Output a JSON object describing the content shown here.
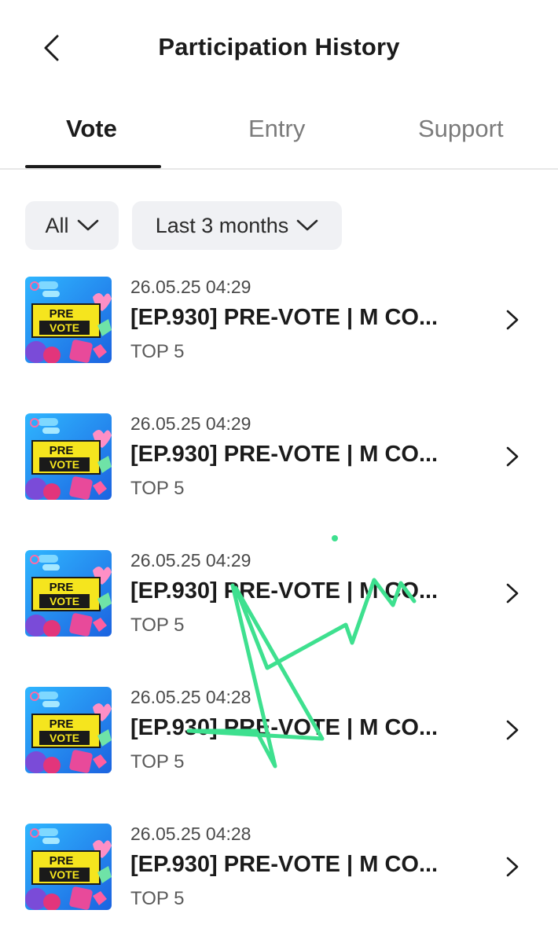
{
  "header": {
    "title": "Participation History"
  },
  "tabs": [
    {
      "label": "Vote",
      "active": true
    },
    {
      "label": "Entry",
      "active": false
    },
    {
      "label": "Support",
      "active": false
    }
  ],
  "filters": {
    "type": "All",
    "period": "Last 3 months"
  },
  "items": [
    {
      "date": "26.05.25 04:29",
      "title": "[EP.930] PRE-VOTE | M CO...",
      "rank": "TOP 5",
      "thumb_text": [
        "PRE",
        "VOTE"
      ]
    },
    {
      "date": "26.05.25 04:29",
      "title": "[EP.930] PRE-VOTE | M CO...",
      "rank": "TOP 5",
      "thumb_text": [
        "PRE",
        "VOTE"
      ]
    },
    {
      "date": "26.05.25 04:29",
      "title": "[EP.930] PRE-VOTE | M CO...",
      "rank": "TOP 5",
      "thumb_text": [
        "PRE",
        "VOTE"
      ]
    },
    {
      "date": "26.05.25 04:28",
      "title": "[EP.930] PRE-VOTE | M CO...",
      "rank": "TOP 5",
      "thumb_text": [
        "PRE",
        "VOTE"
      ]
    },
    {
      "date": "26.05.25 04:28",
      "title": "[EP.930] PRE-VOTE | M CO...",
      "rank": "TOP 5",
      "thumb_text": [
        "PRE",
        "VOTE"
      ]
    }
  ],
  "colors": {
    "accent": "#1b1b1b",
    "scribble": "#3ee08f",
    "thumb_bg": "#2b8ff0",
    "thumb_banner": "#f5e51e"
  },
  "icons": {
    "back": "chevron-left-icon",
    "dropdown": "chevron-down-icon",
    "row": "chevron-right-icon"
  }
}
